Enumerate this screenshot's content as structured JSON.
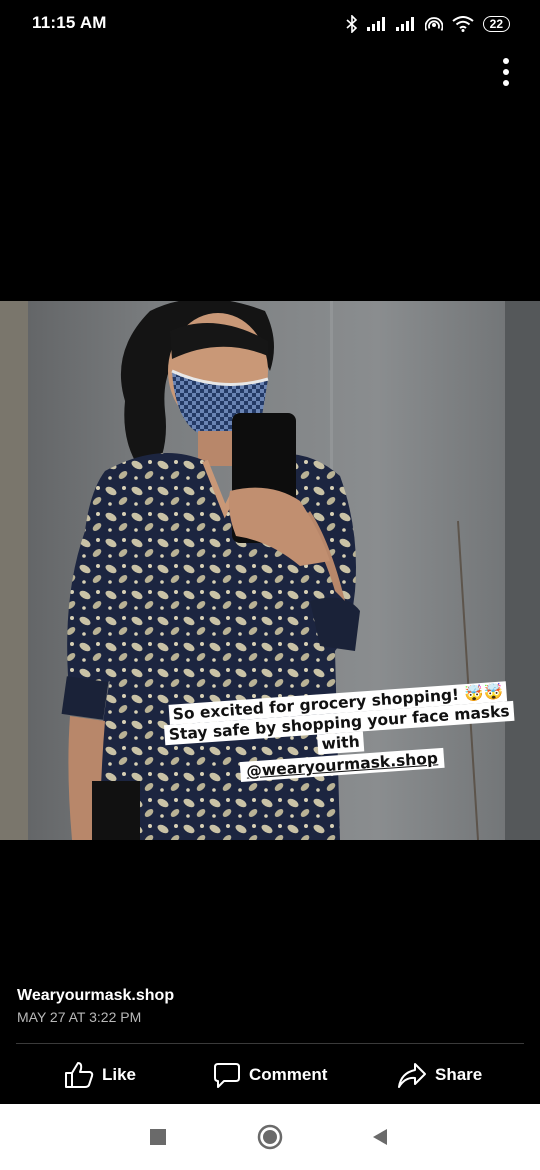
{
  "status_bar": {
    "time": "11:15 AM",
    "battery": "22",
    "icons": [
      "bluetooth-icon",
      "signal-icon",
      "signal-icon",
      "hotspot-icon",
      "wifi-icon",
      "battery-icon"
    ]
  },
  "photo": {
    "sticker_lines": [
      "So excited for grocery shopping! 🤯🤯",
      "Stay safe by shopping your face masks",
      "with",
      "@wearyourmask.shop"
    ]
  },
  "post": {
    "author": "Wearyourmask.shop",
    "timestamp": "MAY 27 AT 3:22 PM"
  },
  "actions": {
    "like_label": "Like",
    "comment_label": "Comment",
    "share_label": "Share"
  },
  "nav": {
    "icons": [
      "recent-apps-icon",
      "home-icon",
      "back-icon"
    ]
  }
}
